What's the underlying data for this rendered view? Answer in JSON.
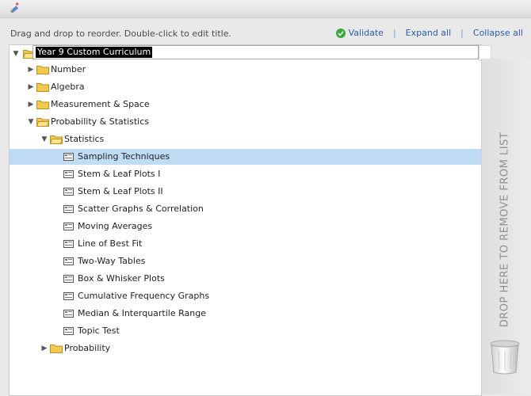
{
  "toolbar": {
    "help_text": "Drag and drop to reorder. Double-click to edit title.",
    "validate_label": "Validate",
    "expand_all_label": "Expand all",
    "collapse_all_label": "Collapse all",
    "separator": "|"
  },
  "tree": {
    "root_title": "Year 9 Custom Curriculum",
    "folders": {
      "number": "Number",
      "algebra": "Algebra",
      "measurement": "Measurement & Space",
      "probability_statistics": "Probability & Statistics",
      "statistics": "Statistics",
      "probability": "Probability"
    },
    "lessons": [
      "Sampling Techniques",
      "Stem & Leaf Plots I",
      "Stem & Leaf Plots II",
      "Scatter Graphs & Correlation",
      "Moving Averages",
      "Line of Best Fit",
      "Two-Way Tables",
      "Box & Whisker Plots",
      "Cumulative Frequency Graphs",
      "Median & Interquartile Range",
      "Topic Test"
    ],
    "selected_lesson": "Sampling Techniques"
  },
  "drop_zone": {
    "label": "DROP HERE TO REMOVE FROM LIST"
  },
  "icons": {
    "folder": "folder-icon",
    "lesson": "lesson-icon",
    "validate": "check-circle-icon",
    "trash": "trash-icon",
    "expanded": "triangle-down",
    "collapsed": "triangle-right"
  },
  "colors": {
    "link": "#2a5db0",
    "selection": "#bfdcf4",
    "folder": "#f2c94c",
    "validate": "#3aa83a"
  }
}
